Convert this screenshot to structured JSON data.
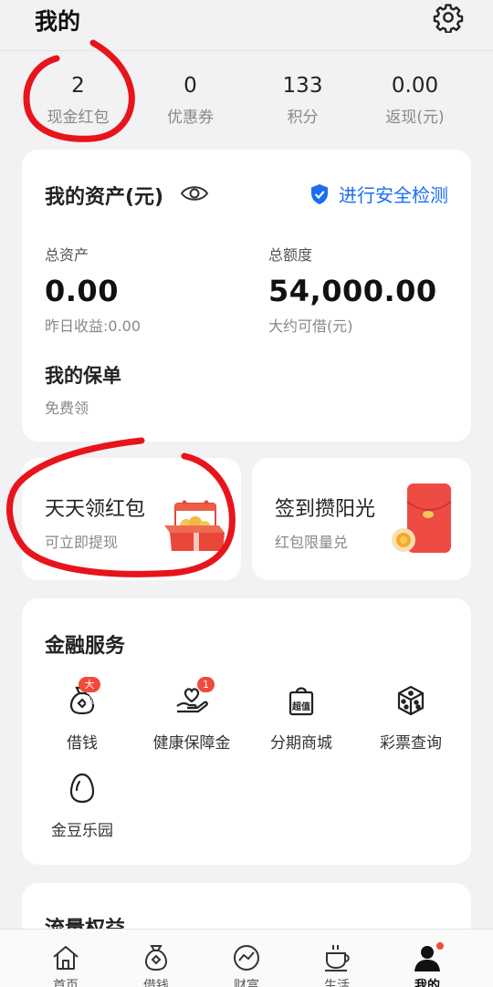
{
  "header": {
    "title": "我的"
  },
  "stats": [
    {
      "value": "2",
      "label": "现金红包"
    },
    {
      "value": "0",
      "label": "优惠券"
    },
    {
      "value": "133",
      "label": "积分"
    },
    {
      "value": "0.00",
      "label": "返现(元)"
    }
  ],
  "assets": {
    "title": "我的资产(元)",
    "security_link": "进行安全检测",
    "total": {
      "label": "总资产",
      "value": "0.00",
      "sub": "昨日收益:0.00"
    },
    "limit": {
      "label": "总额度",
      "value": "54,000.00",
      "sub": "大约可借(元)"
    },
    "policy": {
      "title": "我的保单",
      "sub": "免费领"
    }
  },
  "promos": [
    {
      "title": "天天领红包",
      "sub": "可立即提现",
      "icon": "gift-box-icon"
    },
    {
      "title": "签到攒阳光",
      "sub": "红包限量兑",
      "icon": "red-envelope-icon"
    }
  ],
  "services": {
    "title": "金融服务",
    "items": [
      {
        "label": "借钱",
        "badge": "大额"
      },
      {
        "label": "健康保障金",
        "badge": "1"
      },
      {
        "label": "分期商城",
        "icon_text": "超值"
      },
      {
        "label": "彩票查询"
      },
      {
        "label": "金豆乐园"
      }
    ]
  },
  "flow": {
    "title": "流量权益"
  },
  "tabs": [
    {
      "label": "首页"
    },
    {
      "label": "借钱"
    },
    {
      "label": "财富"
    },
    {
      "label": "生活"
    },
    {
      "label": "我的"
    }
  ],
  "colors": {
    "accent": "#1b6ef3",
    "badge": "#f04a3a",
    "annotation": "#e8141c"
  }
}
